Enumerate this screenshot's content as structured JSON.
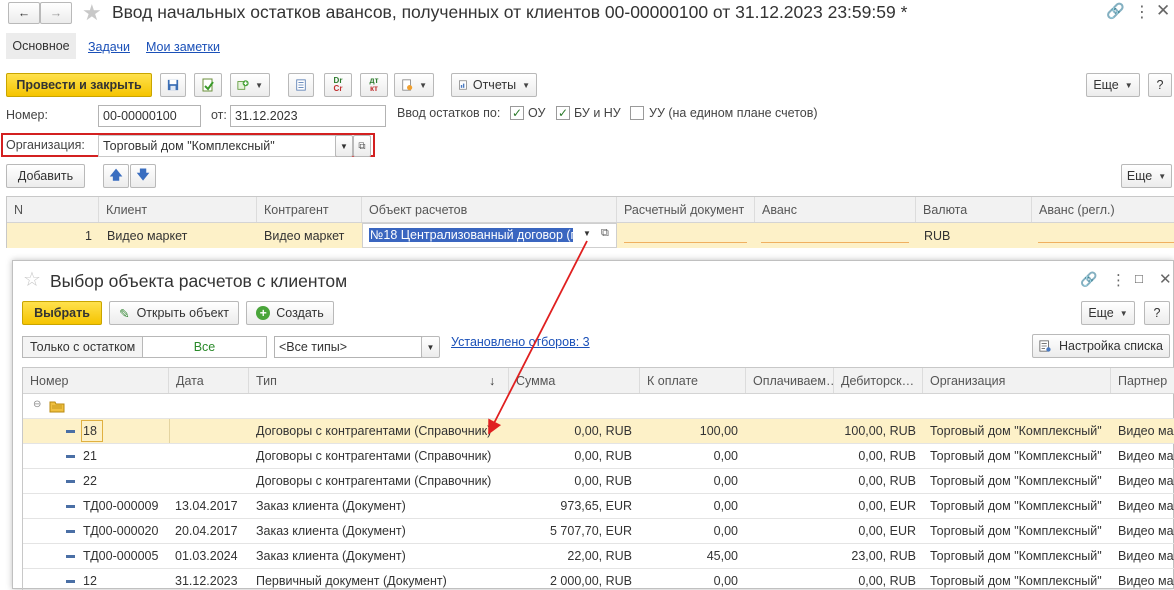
{
  "window": {
    "title": "Ввод начальных остатков авансов, полученных от клиентов 00-00000100 от 31.12.2023 23:59:59 *"
  },
  "tabs": [
    "Основное",
    "Задачи",
    "Мои заметки"
  ],
  "toolbar": {
    "post_close": "Провести и закрыть",
    "reports": "Отчеты",
    "more": "Еще",
    "help": "?",
    "dtkt_dr": "Dr",
    "dtkt_cr": "Cr",
    "dtkt_dt": "дт",
    "dtkt_kt": "кт"
  },
  "form": {
    "number_label": "Номер:",
    "number_value": "00-00000100",
    "date_label": "от:",
    "date_value": "31.12.2023",
    "input_by_label": "Ввод остатков по:",
    "checks": [
      {
        "label": "ОУ",
        "checked": true
      },
      {
        "label": "БУ и НУ",
        "checked": true
      },
      {
        "label": "УУ (на едином плане счетов)",
        "checked": false
      }
    ],
    "org_label": "Организация:",
    "org_value": "Торговый дом \"Комплексный\""
  },
  "table_toolbar": {
    "add": "Добавить",
    "more": "Еще"
  },
  "main_table": {
    "columns": [
      "N",
      "Клиент",
      "Контрагент",
      "Объект расчетов",
      "Расчетный документ",
      "Аванс",
      "Валюта",
      "Аванс (регл.)"
    ],
    "row": {
      "n": "1",
      "client": "Видео маркет",
      "counterparty": "Видео маркет",
      "object": "№18 Централизованный договор (п",
      "currency": "RUB"
    }
  },
  "popup": {
    "title": "Выбор объекта расчетов с клиентом",
    "select": "Выбрать",
    "open_object": "Открыть объект",
    "create": "Создать",
    "more": "Еще",
    "help": "?",
    "filter_only_balance": "Только с остатком",
    "filter_all": "Все",
    "filter_types": "<Все типы>",
    "filters_set": "Установлено отборов: 3",
    "list_settings": "Настройка списка",
    "columns": [
      "Номер",
      "Дата",
      "Тип",
      "Сумма",
      "К оплате",
      "Оплачиваем…",
      "Дебиторск…",
      "Организация",
      "Партнер"
    ],
    "rows": [
      {
        "number": "18",
        "date": "",
        "type": "Договоры с контрагентами (Справочник)",
        "sum": "0,00, RUB",
        "to_pay": "100,00",
        "paid": "",
        "debt": "100,00, RUB",
        "org": "Торговый дом \"Комплексный\"",
        "partner": "Видео ма"
      },
      {
        "number": "21",
        "date": "",
        "type": "Договоры с контрагентами (Справочник)",
        "sum": "0,00, RUB",
        "to_pay": "0,00",
        "paid": "",
        "debt": "0,00, RUB",
        "org": "Торговый дом \"Комплексный\"",
        "partner": "Видео ма"
      },
      {
        "number": "22",
        "date": "",
        "type": "Договоры с контрагентами (Справочник)",
        "sum": "0,00, RUB",
        "to_pay": "0,00",
        "paid": "",
        "debt": "0,00, RUB",
        "org": "Торговый дом \"Комплексный\"",
        "partner": "Видео ма"
      },
      {
        "number": "ТД00-000009",
        "date": "13.04.2017",
        "type": "Заказ клиента (Документ)",
        "sum": "973,65, EUR",
        "to_pay": "0,00",
        "paid": "",
        "debt": "0,00, EUR",
        "org": "Торговый дом \"Комплексный\"",
        "partner": "Видео ма"
      },
      {
        "number": "ТД00-000020",
        "date": "20.04.2017",
        "type": "Заказ клиента (Документ)",
        "sum": "5 707,70, EUR",
        "to_pay": "0,00",
        "paid": "",
        "debt": "0,00, EUR",
        "org": "Торговый дом \"Комплексный\"",
        "partner": "Видео ма"
      },
      {
        "number": "ТД00-000005",
        "date": "01.03.2024",
        "type": "Заказ клиента (Документ)",
        "sum": "22,00, RUB",
        "to_pay": "45,00",
        "paid": "",
        "debt": "23,00, RUB",
        "org": "Торговый дом \"Комплексный\"",
        "partner": "Видео ма"
      },
      {
        "number": "12",
        "date": "31.12.2023",
        "type": "Первичный документ (Документ)",
        "sum": "2 000,00, RUB",
        "to_pay": "0,00",
        "paid": "",
        "debt": "0,00, RUB",
        "org": "Торговый дом \"Комплексный\"",
        "partner": "Видео ма"
      }
    ]
  },
  "colors": {
    "accent": "#f5c400",
    "selection": "#fdf1c8",
    "highlight_border": "#d32020",
    "link": "#1a50b8"
  }
}
